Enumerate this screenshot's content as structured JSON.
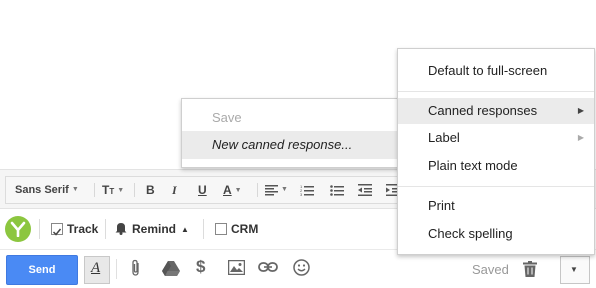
{
  "format_toolbar": {
    "font_family": "Sans Serif",
    "size_icon": "text-size-icon",
    "bold_label": "B",
    "italic_label": "I",
    "underline_label": "U",
    "text_color_label": "A"
  },
  "tracking_bar": {
    "logo_icon": "yesware-y-icon",
    "track_label": "Track",
    "remind_label": "Remind",
    "crm_label": "CRM"
  },
  "bottom_bar": {
    "send_label": "Send",
    "format_icon": "A",
    "saved_label": "Saved"
  },
  "canned_submenu": {
    "items": [
      {
        "label": "Save",
        "disabled": true
      },
      {
        "label": "New canned response...",
        "highlighted": true
      }
    ]
  },
  "more_menu": {
    "items": [
      {
        "label": "Default to full-screen"
      },
      {
        "label": "Canned responses",
        "highlighted": true,
        "has_submenu": true
      },
      {
        "label": "Label",
        "has_submenu": true
      },
      {
        "label": "Plain text mode"
      },
      {
        "label": "Print"
      },
      {
        "label": "Check spelling"
      }
    ],
    "submenu_arrow": "▶"
  },
  "colors": {
    "send_blue": "#4a8af4",
    "logo_green": "#8cc63f",
    "highlight": "#ebebeb"
  }
}
